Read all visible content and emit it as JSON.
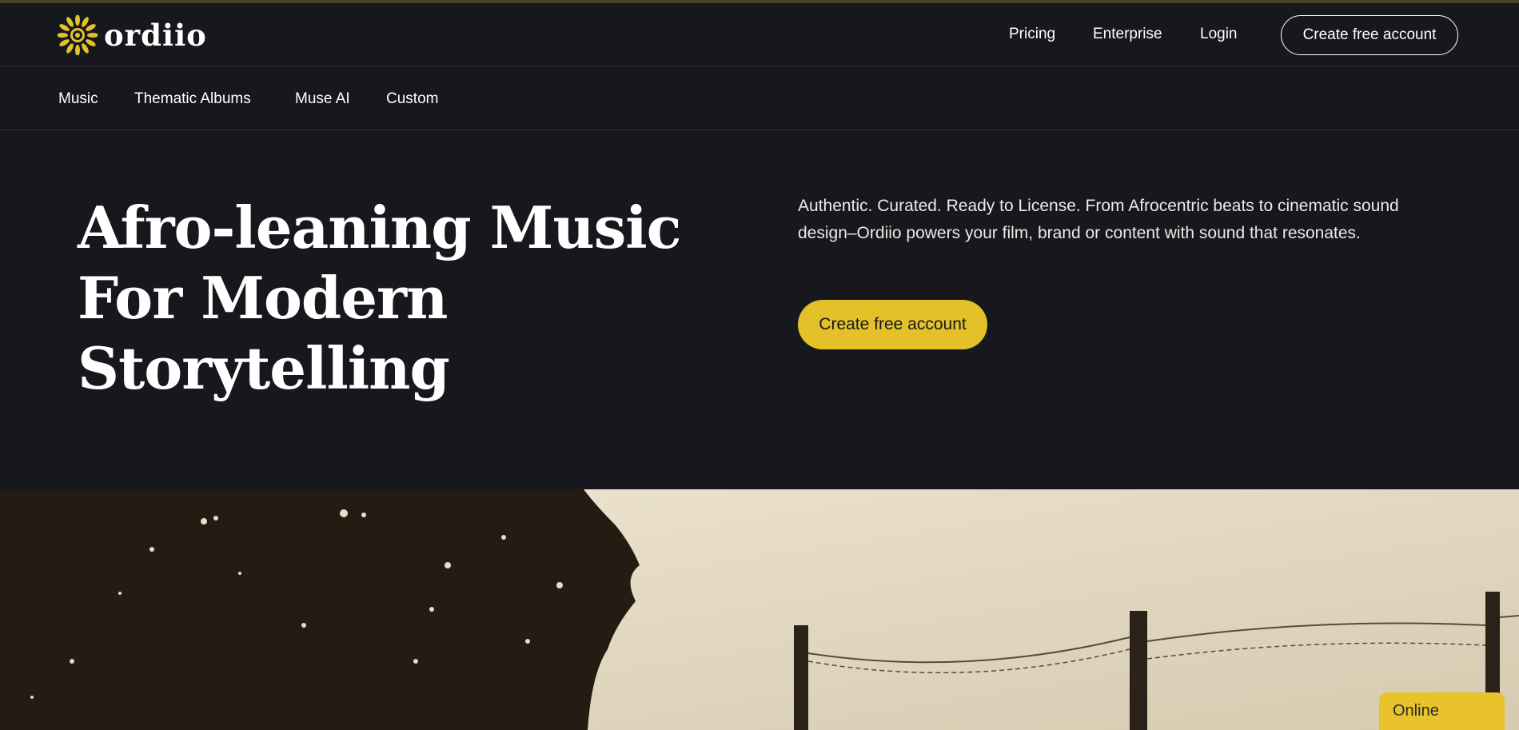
{
  "brand": {
    "name": "ordiio",
    "accent_color": "#e4c128",
    "background_color": "#17181e"
  },
  "top_nav": {
    "pricing": "Pricing",
    "enterprise": "Enterprise",
    "login": "Login",
    "create_account": "Create free account"
  },
  "sub_nav": {
    "items": [
      "Music",
      "Thematic Albums",
      "Muse AI",
      "Custom"
    ]
  },
  "hero": {
    "title_line1": "Afro-leaning Music",
    "title_line2": "For Modern",
    "title_line3": "Storytelling",
    "description": "Authentic. Curated. Ready to License. From Afrocentric beats to cinematic sound design–Ordiio powers your film, brand or content with sound that resonates.",
    "cta": "Create free account"
  },
  "chat_widget": {
    "status": "Online"
  }
}
